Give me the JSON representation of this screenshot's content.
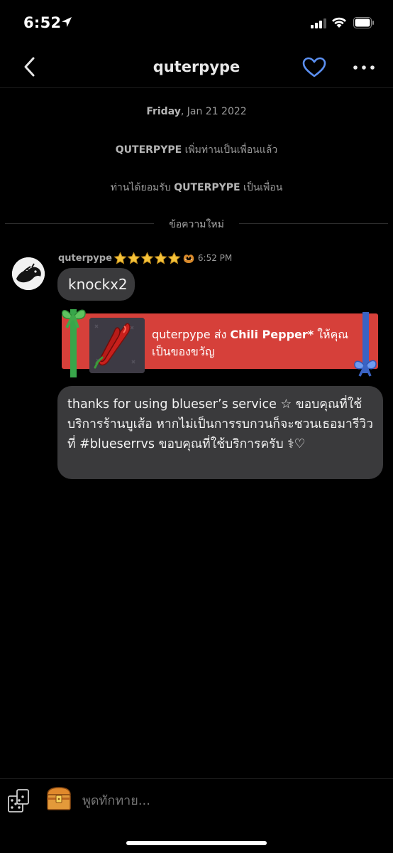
{
  "status_bar": {
    "time": "6:52",
    "icons": [
      "location-arrow-icon",
      "cellular-signal-icon",
      "wifi-icon",
      "battery-icon"
    ]
  },
  "header": {
    "title": "quterpype",
    "back_icon": "chevron-left-icon",
    "favorite_icon": "heart-outline-icon",
    "more_icon": "more-dots-icon",
    "accent_color": "#5b8ff0"
  },
  "system_messages": {
    "date_day": "Friday",
    "date_rest": ", Jan 21 2022",
    "friend_added_name": "QUTERPYPE",
    "friend_added_text": " เพิ่มท่านเป็นเพื่อนแล้ว",
    "accepted_prefix": "ท่านได้ยอมรับ ",
    "accepted_name": "QUTERPYPE",
    "accepted_suffix": " เป็นเพื่อน",
    "new_messages_label": "ข้อความใหม่"
  },
  "message": {
    "username": "quterpype",
    "star_count": 5,
    "badge_icon": "pretzel-icon",
    "time": "6:52 PM",
    "text_1": "knockx2",
    "gift": {
      "sender": "quterpype",
      "verb": " ส่ง ",
      "item": "Chili Pepper*",
      "suffix": " ให้คุณเป็นของขวัญ",
      "item_icon": "chili-pepper-icon",
      "card_color": "#d6403a"
    },
    "text_2": "thanks for using blueser’s service ☆ ขอบคุณที่ใช้บริการร้านบูเส้อ หากไม่เป็นการรบกวนก็จะชวนเธอมารีวิวที่ #blueserrvs ขอบคุณที่ใช้บริการครับ ⚕♡"
  },
  "input_bar": {
    "placeholder": "พูดทักทาย...",
    "left_icons": [
      "dice-icon",
      "treasure-chest-icon"
    ]
  }
}
